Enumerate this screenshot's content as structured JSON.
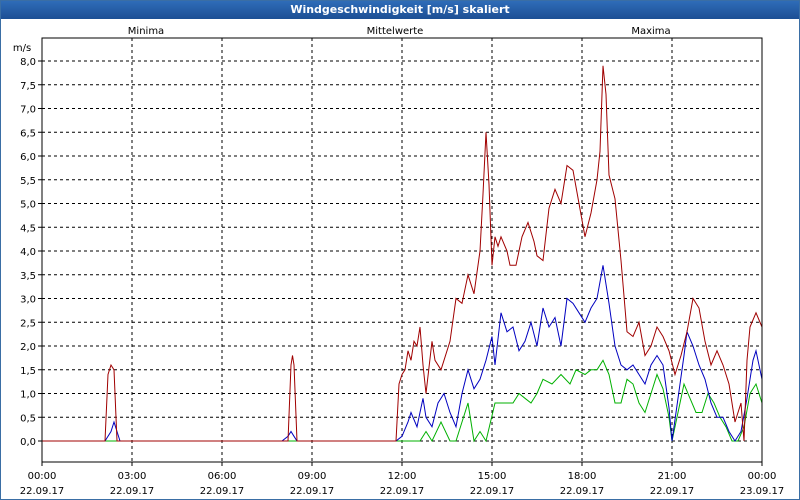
{
  "window": {
    "title": "Windgeschwindigkeit [m/s] skaliert"
  },
  "chart_data": {
    "type": "line",
    "title": "Windgeschwindigkeit [m/s] skaliert",
    "ylabel": "m/s",
    "ylim": [
      0,
      8
    ],
    "yticks": [
      "0,0",
      "0,5",
      "1,0",
      "1,5",
      "2,0",
      "2,5",
      "3,0",
      "3,5",
      "4,0",
      "4,5",
      "5,0",
      "5,5",
      "6,0",
      "6,5",
      "7,0",
      "7,5",
      "8,0"
    ],
    "xlim": [
      0,
      24
    ],
    "xticks": [
      {
        "time": "00:00",
        "date": "22.09.17"
      },
      {
        "time": "03:00",
        "date": "22.09.17"
      },
      {
        "time": "06:00",
        "date": "22.09.17"
      },
      {
        "time": "09:00",
        "date": "22.09.17"
      },
      {
        "time": "12:00",
        "date": "22.09.17"
      },
      {
        "time": "15:00",
        "date": "22.09.17"
      },
      {
        "time": "18:00",
        "date": "22.09.17"
      },
      {
        "time": "21:00",
        "date": "22.09.17"
      },
      {
        "time": "00:00",
        "date": "23.09.17"
      }
    ],
    "grid": true,
    "legend_position": "top",
    "series": [
      {
        "name": "Minima",
        "color": "#00b000",
        "points": [
          [
            0,
            0
          ],
          [
            12.3,
            0
          ],
          [
            12.6,
            0
          ],
          [
            12.8,
            0.2
          ],
          [
            13,
            0
          ],
          [
            13.3,
            0.4
          ],
          [
            13.6,
            0
          ],
          [
            13.8,
            0
          ],
          [
            14.2,
            0.8
          ],
          [
            14.4,
            0
          ],
          [
            14.6,
            0.2
          ],
          [
            14.8,
            0
          ],
          [
            15.1,
            0.8
          ],
          [
            15.3,
            0.8
          ],
          [
            15.5,
            0.8
          ],
          [
            15.7,
            0.8
          ],
          [
            15.9,
            1.0
          ],
          [
            16.1,
            0.9
          ],
          [
            16.3,
            0.8
          ],
          [
            16.5,
            1.0
          ],
          [
            16.7,
            1.3
          ],
          [
            17,
            1.2
          ],
          [
            17.3,
            1.4
          ],
          [
            17.6,
            1.2
          ],
          [
            17.8,
            1.5
          ],
          [
            18.1,
            1.4
          ],
          [
            18.3,
            1.5
          ],
          [
            18.5,
            1.5
          ],
          [
            18.7,
            1.7
          ],
          [
            18.9,
            1.4
          ],
          [
            19.1,
            0.8
          ],
          [
            19.3,
            0.8
          ],
          [
            19.5,
            1.3
          ],
          [
            19.7,
            1.2
          ],
          [
            19.9,
            0.8
          ],
          [
            20.1,
            0.6
          ],
          [
            20.3,
            1.0
          ],
          [
            20.5,
            1.4
          ],
          [
            20.7,
            1.1
          ],
          [
            20.9,
            0.5
          ],
          [
            21,
            0
          ],
          [
            21.2,
            0.6
          ],
          [
            21.4,
            1.2
          ],
          [
            21.6,
            0.9
          ],
          [
            21.8,
            0.6
          ],
          [
            22,
            0.6
          ],
          [
            22.2,
            1.0
          ],
          [
            22.4,
            0.8
          ],
          [
            22.6,
            0.5
          ],
          [
            22.8,
            0.3
          ],
          [
            23,
            0
          ],
          [
            23.2,
            0
          ],
          [
            23.4,
            0.3
          ],
          [
            23.6,
            1.0
          ],
          [
            23.8,
            1.2
          ],
          [
            24,
            0.8
          ]
        ]
      },
      {
        "name": "Mittelwerte",
        "color": "#0000c0",
        "points": [
          [
            0,
            0
          ],
          [
            2.1,
            0
          ],
          [
            2.3,
            0.2
          ],
          [
            2.4,
            0.4
          ],
          [
            2.5,
            0.2
          ],
          [
            2.6,
            0
          ],
          [
            8,
            0
          ],
          [
            8.2,
            0.1
          ],
          [
            8.3,
            0.2
          ],
          [
            8.4,
            0.1
          ],
          [
            8.5,
            0
          ],
          [
            11.8,
            0
          ],
          [
            12,
            0.1
          ],
          [
            12.2,
            0.4
          ],
          [
            12.3,
            0.6
          ],
          [
            12.5,
            0.3
          ],
          [
            12.6,
            0.6
          ],
          [
            12.7,
            0.9
          ],
          [
            12.8,
            0.5
          ],
          [
            13,
            0.3
          ],
          [
            13.2,
            0.8
          ],
          [
            13.4,
            1.0
          ],
          [
            13.6,
            0.6
          ],
          [
            13.8,
            0.3
          ],
          [
            14,
            1.0
          ],
          [
            14.2,
            1.5
          ],
          [
            14.4,
            1.1
          ],
          [
            14.6,
            1.3
          ],
          [
            14.8,
            1.7
          ],
          [
            15,
            2.2
          ],
          [
            15.1,
            1.6
          ],
          [
            15.3,
            2.7
          ],
          [
            15.5,
            2.3
          ],
          [
            15.7,
            2.4
          ],
          [
            15.9,
            1.9
          ],
          [
            16.1,
            2.1
          ],
          [
            16.3,
            2.5
          ],
          [
            16.5,
            2.0
          ],
          [
            16.7,
            2.8
          ],
          [
            16.9,
            2.4
          ],
          [
            17.1,
            2.6
          ],
          [
            17.3,
            2.0
          ],
          [
            17.5,
            3.0
          ],
          [
            17.7,
            2.9
          ],
          [
            17.9,
            2.7
          ],
          [
            18.1,
            2.5
          ],
          [
            18.3,
            2.8
          ],
          [
            18.5,
            3.0
          ],
          [
            18.7,
            3.7
          ],
          [
            18.9,
            2.9
          ],
          [
            19.1,
            2.0
          ],
          [
            19.3,
            1.6
          ],
          [
            19.5,
            1.5
          ],
          [
            19.7,
            1.6
          ],
          [
            19.9,
            1.4
          ],
          [
            20.1,
            1.2
          ],
          [
            20.3,
            1.6
          ],
          [
            20.5,
            1.8
          ],
          [
            20.7,
            1.6
          ],
          [
            20.9,
            0.7
          ],
          [
            21,
            0
          ],
          [
            21.2,
            0.9
          ],
          [
            21.4,
            1.8
          ],
          [
            21.5,
            2.3
          ],
          [
            21.7,
            2.0
          ],
          [
            21.9,
            1.6
          ],
          [
            22.1,
            1.3
          ],
          [
            22.3,
            0.8
          ],
          [
            22.5,
            0.5
          ],
          [
            22.7,
            0.5
          ],
          [
            22.9,
            0.2
          ],
          [
            23.1,
            0
          ],
          [
            23.3,
            0.2
          ],
          [
            23.5,
            0.9
          ],
          [
            23.7,
            1.7
          ],
          [
            23.8,
            1.9
          ],
          [
            24,
            1.3
          ]
        ]
      },
      {
        "name": "Maxima",
        "color": "#a00000",
        "points": [
          [
            0,
            0
          ],
          [
            2.1,
            0
          ],
          [
            2.2,
            1.4
          ],
          [
            2.3,
            1.6
          ],
          [
            2.4,
            1.5
          ],
          [
            2.5,
            0
          ],
          [
            8.2,
            0
          ],
          [
            8.3,
            1.6
          ],
          [
            8.35,
            1.8
          ],
          [
            8.4,
            1.6
          ],
          [
            8.5,
            0
          ],
          [
            11.8,
            0
          ],
          [
            11.9,
            1.2
          ],
          [
            12,
            1.4
          ],
          [
            12.1,
            1.5
          ],
          [
            12.2,
            1.9
          ],
          [
            12.3,
            1.7
          ],
          [
            12.4,
            2.1
          ],
          [
            12.5,
            2.0
          ],
          [
            12.6,
            2.4
          ],
          [
            12.7,
            1.6
          ],
          [
            12.8,
            1.0
          ],
          [
            13.0,
            2.1
          ],
          [
            13.1,
            1.7
          ],
          [
            13.3,
            1.5
          ],
          [
            13.6,
            2.1
          ],
          [
            13.8,
            3.0
          ],
          [
            14.0,
            2.9
          ],
          [
            14.2,
            3.5
          ],
          [
            14.4,
            3.1
          ],
          [
            14.6,
            4.0
          ],
          [
            14.7,
            5.2
          ],
          [
            14.8,
            6.5
          ],
          [
            14.9,
            5.4
          ],
          [
            15.0,
            3.7
          ],
          [
            15.1,
            4.3
          ],
          [
            15.2,
            4.1
          ],
          [
            15.3,
            4.3
          ],
          [
            15.5,
            4.0
          ],
          [
            15.6,
            3.7
          ],
          [
            15.8,
            3.7
          ],
          [
            16.0,
            4.3
          ],
          [
            16.2,
            4.6
          ],
          [
            16.4,
            4.2
          ],
          [
            16.5,
            3.9
          ],
          [
            16.7,
            3.8
          ],
          [
            16.9,
            4.9
          ],
          [
            17.1,
            5.3
          ],
          [
            17.3,
            5.0
          ],
          [
            17.5,
            5.8
          ],
          [
            17.7,
            5.7
          ],
          [
            17.9,
            5.0
          ],
          [
            18.1,
            4.3
          ],
          [
            18.3,
            4.8
          ],
          [
            18.5,
            5.5
          ],
          [
            18.6,
            6.1
          ],
          [
            18.7,
            7.9
          ],
          [
            18.8,
            7.3
          ],
          [
            18.9,
            5.6
          ],
          [
            19.1,
            5.1
          ],
          [
            19.3,
            3.8
          ],
          [
            19.5,
            2.3
          ],
          [
            19.7,
            2.2
          ],
          [
            19.9,
            2.5
          ],
          [
            20.1,
            1.8
          ],
          [
            20.3,
            2.0
          ],
          [
            20.5,
            2.4
          ],
          [
            20.7,
            2.2
          ],
          [
            20.9,
            1.9
          ],
          [
            21.1,
            1.4
          ],
          [
            21.3,
            1.8
          ],
          [
            21.5,
            2.3
          ],
          [
            21.7,
            3.0
          ],
          [
            21.9,
            2.8
          ],
          [
            22.1,
            2.1
          ],
          [
            22.3,
            1.6
          ],
          [
            22.5,
            1.9
          ],
          [
            22.7,
            1.6
          ],
          [
            22.9,
            1.2
          ],
          [
            23.1,
            0.4
          ],
          [
            23.3,
            0.8
          ],
          [
            23.4,
            0
          ],
          [
            23.5,
            1.7
          ],
          [
            23.6,
            2.4
          ],
          [
            23.8,
            2.7
          ],
          [
            24,
            2.4
          ]
        ]
      }
    ]
  }
}
